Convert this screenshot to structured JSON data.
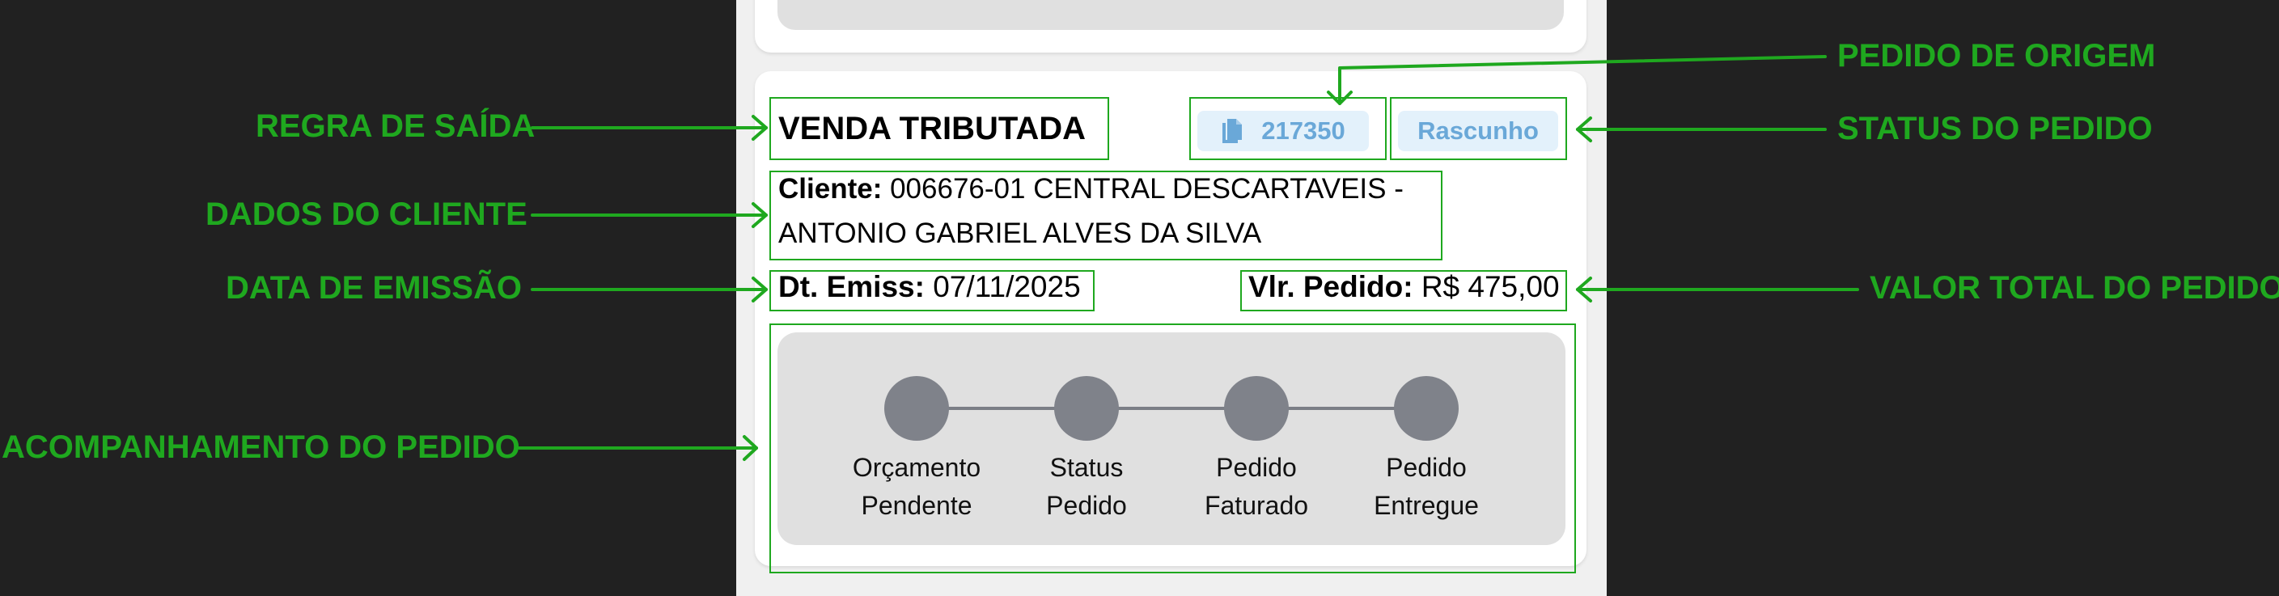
{
  "order": {
    "exit_rule": "VENDA TRIBUTADA",
    "origin_order_number": "217350",
    "status": "Rascunho",
    "client_label": "Cliente:",
    "client_value": "006676-01 CENTRAL DESCARTAVEIS - ANTONIO GABRIEL ALVES DA SILVA",
    "emission_label": "Dt. Emiss:",
    "emission_value": "07/11/2025",
    "total_label": "Vlr. Pedido:",
    "total_value": "R$ 475,00"
  },
  "tracking": {
    "steps": [
      {
        "line1": "Orçamento",
        "line2": "Pendente"
      },
      {
        "line1": "Status",
        "line2": "Pedido"
      },
      {
        "line1": "Pedido",
        "line2": "Faturado"
      },
      {
        "line1": "Pedido",
        "line2": "Entregue"
      }
    ]
  },
  "annotations": {
    "exit_rule": "REGRA DE SAÍDA",
    "client_data": "DADOS DO CLIENTE",
    "emission_date": "DATA DE EMISSÃO",
    "order_tracking": "ACOMPANHAMENTO DO PEDIDO",
    "origin_order": "PEDIDO DE ORIGEM",
    "order_status": "STATUS DO PEDIDO",
    "order_total": "VALOR TOTAL DO PEDIDO"
  },
  "colors": {
    "annotation": "#1fa81f",
    "background": "#212121",
    "badge_bg": "#e3f1fb",
    "badge_text": "#6aa8d8",
    "step_dot": "#7f828a"
  },
  "icons": {
    "origin_order": "copy-document-icon"
  }
}
